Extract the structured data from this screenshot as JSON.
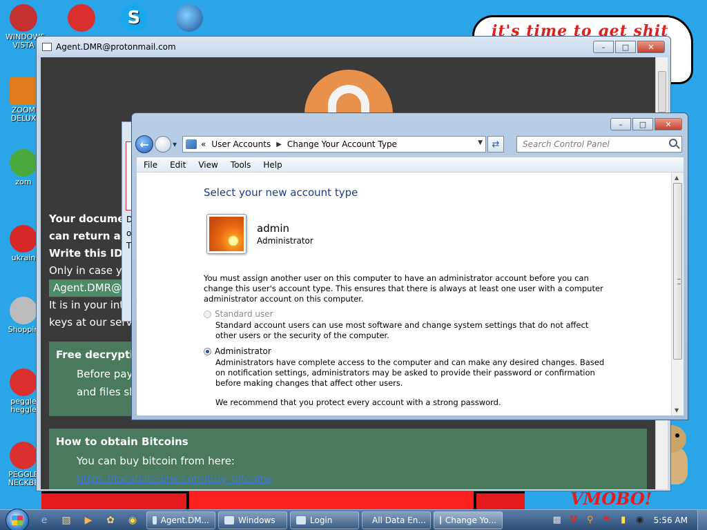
{
  "desktop": {
    "banner_text": "it's time to get shit",
    "bottom_text": "VMOBO!",
    "icons": [
      {
        "label": "WINDOWS VISTA",
        "color": "#c53030"
      },
      {
        "label": "ZOOM DELUX",
        "color": "#e07b1a"
      },
      {
        "label": "zom",
        "color": "#4aa93d"
      },
      {
        "label": "ukrain",
        "color": "#d62828"
      },
      {
        "label": "Shoppin",
        "color": "#bbbbbb"
      },
      {
        "label": "peggle heggle",
        "color": "#d92f2f"
      },
      {
        "label": "PEGGLE NECKBE",
        "color": "#d92f2f"
      }
    ]
  },
  "ransom_window": {
    "title": "Agent.DMR@protonmail.com",
    "line1": "Your documen",
    "line2": "can return all",
    "line3": "Write this ID i",
    "line4": "Only in case you",
    "email": "Agent.DMR@ac",
    "line5": "It is in your inter",
    "line6": "keys at our serv",
    "free_heading": "Free decryptio",
    "free_line1": "Before payin",
    "free_line2": "and files sho",
    "btc_heading": "How to obtain Bitcoins",
    "btc_line1": "You can buy bitcoin from here:",
    "btc_link": "https://localbitcoins.com/buy_bitcoins"
  },
  "behind_dialog": {
    "lines": [
      "D",
      "o",
      "T"
    ]
  },
  "control_panel": {
    "address": {
      "chevrons": "«",
      "crumb1": "User Accounts",
      "crumb2": "Change Your Account Type"
    },
    "search_placeholder": "Search Control Panel",
    "menu": [
      "File",
      "Edit",
      "View",
      "Tools",
      "Help"
    ],
    "heading": "Select your new account type",
    "user": {
      "name": "admin",
      "type": "Administrator"
    },
    "info": "You must assign another user on this computer to have an administrator account before you can change this user's account type. This ensures that there is always at least one user with a computer administrator account on this computer.",
    "options": [
      {
        "label": "Standard user",
        "description": "Standard account users can use most software and change system settings that do not affect other users or the security of the computer.",
        "selected": false,
        "disabled": true
      },
      {
        "label": "Administrator",
        "description": "Administrators have complete access to the computer and can make any desired changes. Based on notification settings, administrators may be asked to provide their password or confirmation before making changes that affect other users.",
        "selected": true,
        "disabled": false
      }
    ],
    "recommend": "We recommend that you protect every account with a strong password."
  },
  "taskbar": {
    "buttons": [
      {
        "label": "Agent.DM..."
      },
      {
        "label": "Windows"
      },
      {
        "label": "Login"
      },
      {
        "label": "All Data En..."
      },
      {
        "label": "Change Yo..."
      }
    ],
    "clock": "5:56 AM"
  }
}
